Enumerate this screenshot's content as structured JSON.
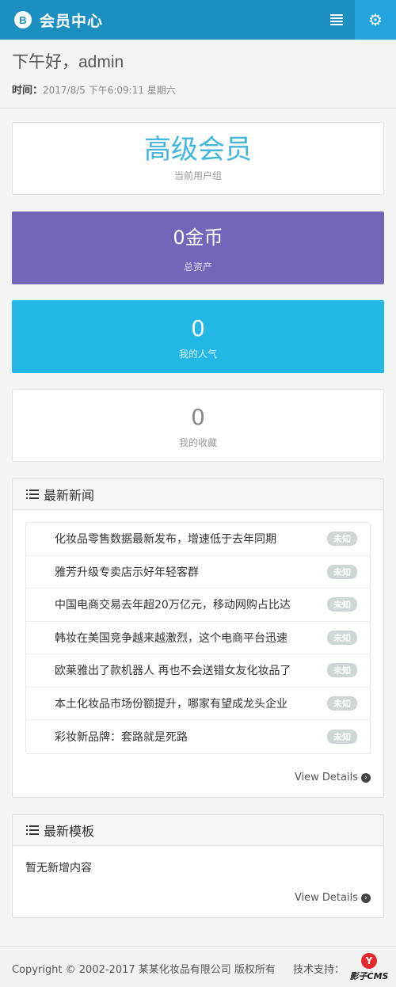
{
  "header": {
    "brand_badge": "B",
    "title": "会员中心",
    "menu_icon": "list-icon",
    "settings_icon": "gear-icon",
    "settings_glyph": "⚙"
  },
  "greeting": {
    "text": "下午好，admin",
    "time_label": "时间：",
    "time_value": "2017/8/5 下午6:09:11 星期六"
  },
  "stats": [
    {
      "value": "高级会员",
      "label": "当前用户组",
      "color": "#44b6de"
    },
    {
      "value": "0金币",
      "label": "总资产",
      "color": "#7266ba"
    },
    {
      "value": "0",
      "label": "我的人气",
      "color": "#23b7e5"
    },
    {
      "value": "0",
      "label": "我的收藏",
      "color": "#ffffff"
    }
  ],
  "news": {
    "title": "最新新闻",
    "items": [
      {
        "title": "化妆品零售数据最新发布，增速低于去年同期",
        "tag": "未知"
      },
      {
        "title": "雅芳升级专卖店示好年轻客群",
        "tag": "未知"
      },
      {
        "title": "中国电商交易去年超20万亿元，移动网购占比达",
        "tag": "未知"
      },
      {
        "title": "韩妆在美国竞争越来越激烈，这个电商平台迅速",
        "tag": "未知"
      },
      {
        "title": "欧莱雅出了款机器人 再也不会送错女友化妆品了",
        "tag": "未知"
      },
      {
        "title": "本土化妆品市场份额提升，哪家有望成龙头企业",
        "tag": "未知"
      },
      {
        "title": "彩妆新品牌：套路就是死路",
        "tag": "未知"
      }
    ],
    "details_label": "View Details"
  },
  "templates": {
    "title": "最新模板",
    "empty_text": "暂无新增内容",
    "details_label": "View Details"
  },
  "footer": {
    "copyright": "Copyright © 2002-2017 某某化妆品有限公司 版权所有",
    "support_label": "技术支持：",
    "logo_mark": "Y",
    "logo_text": "影子CMS"
  },
  "colors": {
    "header": "#1b8fc0",
    "settings_bg": "#24a4de",
    "purple": "#7266ba",
    "cyan": "#23b7e5",
    "tag": "#cfd6d8"
  }
}
